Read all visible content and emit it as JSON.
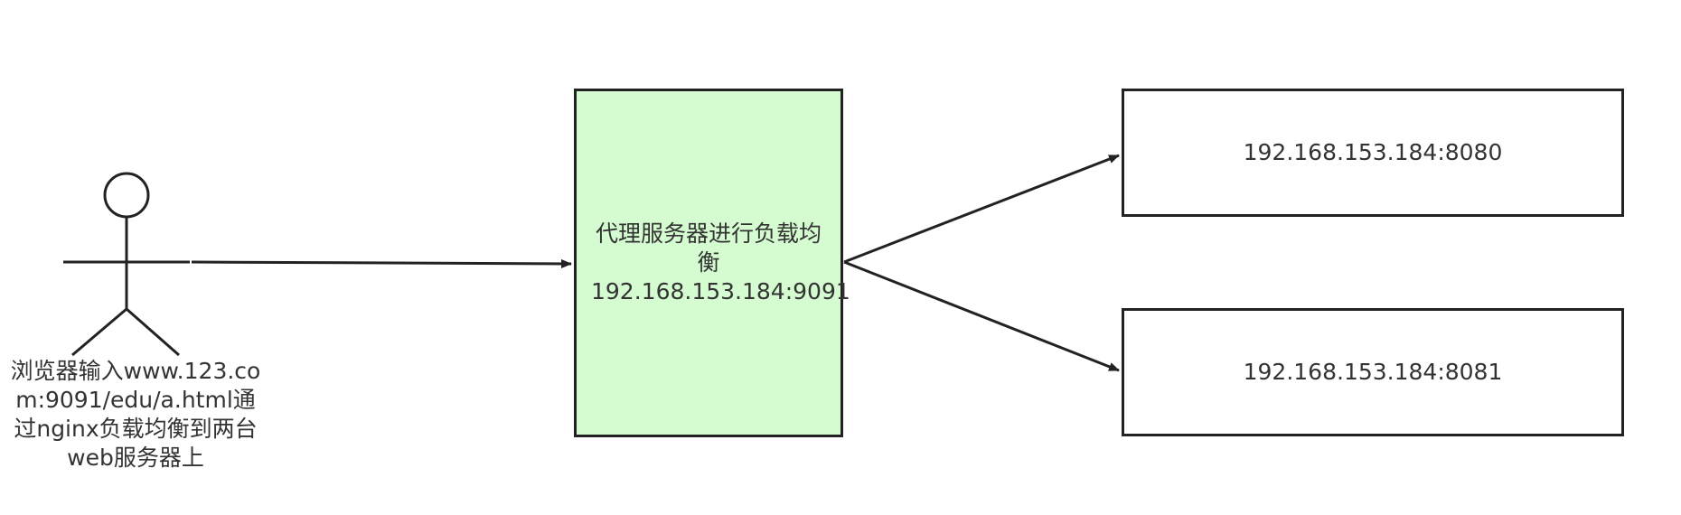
{
  "user": {
    "label": "浏览器输入www.123.com:9091/edu/a.html通过nginx负载均衡到两台web服务器上"
  },
  "proxy": {
    "label_line1": "代理服务器进行负载均衡",
    "label_line2": "192.168.153.184:9091",
    "fill_color": "#d4fcd0"
  },
  "servers": [
    {
      "label": "192.168.153.184:8080"
    },
    {
      "label": "192.168.153.184:8081"
    }
  ],
  "colors": {
    "stroke": "#222222",
    "text": "#333333"
  }
}
